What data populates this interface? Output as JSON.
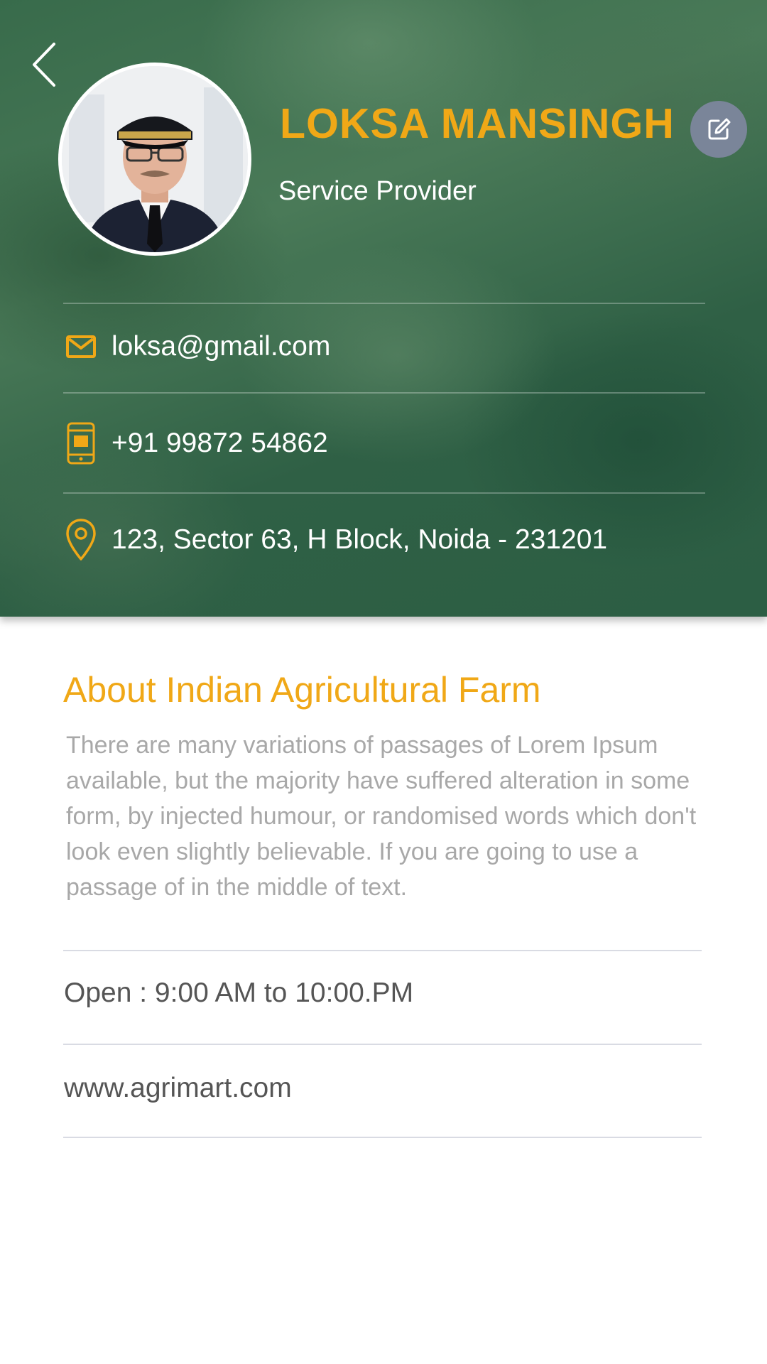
{
  "profile": {
    "name": "LOKSA MANSINGH",
    "role": "Service Provider"
  },
  "contact": {
    "email": "loksa@gmail.com",
    "phone": "+91 99872 54862",
    "address": "123, Sector 63, H Block, Noida - 231201"
  },
  "about": {
    "title": "About Indian Agricultural Farm",
    "body": "There are many variations of passages of Lorem Ipsum available, but the majority have suffered alteration in some form, by injected humour, or randomised words which don't look even slightly believable. If you are going to use a passage of in the middle of text."
  },
  "info": {
    "hours": "Open : 9:00 AM to 10:00.PM",
    "website": "www.agrimart.com"
  },
  "icons": {
    "back": "chevron-left-icon",
    "edit": "edit-square-icon",
    "email": "mail-icon",
    "phone": "mobile-phone-icon",
    "address": "location-pin-icon"
  },
  "colors": {
    "accent": "#f0a817",
    "header_green": "#386b4b",
    "edit_button": "#7a8599",
    "body_text": "#a8a8a8",
    "info_text": "#555555"
  }
}
